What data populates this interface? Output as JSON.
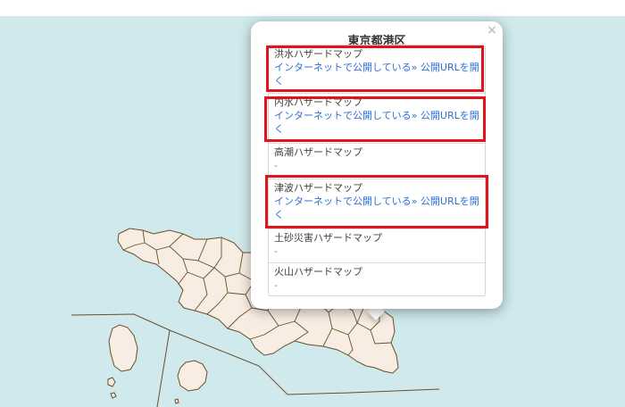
{
  "map": {
    "sea_color": "#cfe9ec",
    "land_color": "#f7ede2",
    "border_color": "#6b4e2c"
  },
  "popup": {
    "title": "東京都港区",
    "close_label": "×",
    "items": [
      {
        "name": "洪水ハザードマップ",
        "link_text": "インターネットで公開している",
        "separator": "»",
        "open_url_text": "公開URLを開く",
        "highlighted": true
      },
      {
        "name": "内水ハザードマップ",
        "link_text": "インターネットで公開している",
        "separator": "»",
        "open_url_text": "公開URLを開く",
        "highlighted": true
      },
      {
        "name": "高潮ハザードマップ",
        "value": "-"
      },
      {
        "name": "津波ハザードマップ",
        "link_text": "インターネットで公開している",
        "separator": "»",
        "open_url_text": "公開URLを開く",
        "highlighted": true
      },
      {
        "name": "土砂災害ハザードマップ",
        "value": "-"
      },
      {
        "name": "火山ハザードマップ",
        "value": "-"
      }
    ],
    "highlight_color": "#e0141e"
  }
}
